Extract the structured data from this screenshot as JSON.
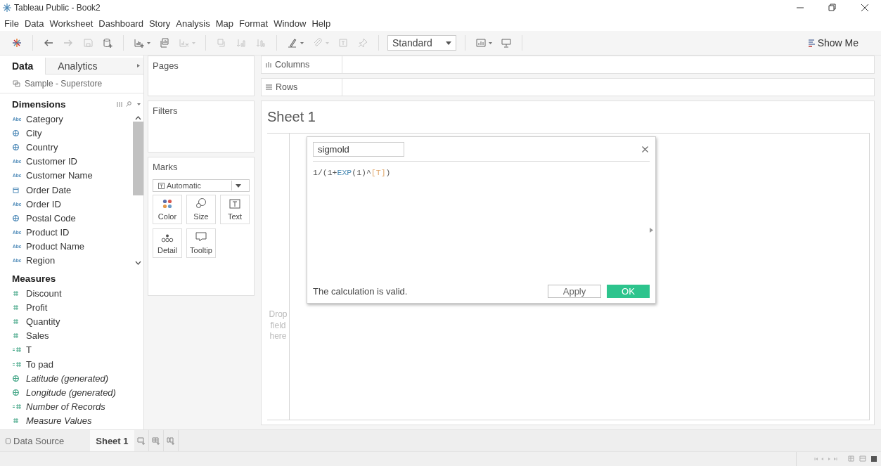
{
  "window": {
    "title": "Tableau Public - Book2"
  },
  "menu": [
    "File",
    "Data",
    "Worksheet",
    "Dashboard",
    "Story",
    "Analysis",
    "Map",
    "Format",
    "Window",
    "Help"
  ],
  "toolbar": {
    "groups": [
      [
        {
          "kind": "logo",
          "disabled": false,
          "dropdown": false
        }
      ],
      [
        {
          "kind": "undo",
          "disabled": false,
          "dropdown": false
        },
        {
          "kind": "redo",
          "disabled": true,
          "dropdown": false
        },
        {
          "kind": "save",
          "disabled": true,
          "dropdown": false
        },
        {
          "kind": "add-source",
          "disabled": false,
          "dropdown": false
        }
      ],
      [
        {
          "kind": "new-sheet",
          "disabled": false,
          "dropdown": true
        },
        {
          "kind": "duplicate",
          "disabled": false,
          "dropdown": false
        },
        {
          "kind": "clear",
          "disabled": true,
          "dropdown": true
        }
      ],
      [
        {
          "kind": "swap",
          "disabled": true,
          "dropdown": false
        },
        {
          "kind": "sort-asc",
          "disabled": true,
          "dropdown": false
        },
        {
          "kind": "sort-desc",
          "disabled": true,
          "dropdown": false
        }
      ],
      [
        {
          "kind": "highlight",
          "disabled": false,
          "dropdown": true
        },
        {
          "kind": "group",
          "disabled": true,
          "dropdown": true
        },
        {
          "kind": "labels",
          "disabled": true,
          "dropdown": false
        },
        {
          "kind": "pin",
          "disabled": true,
          "dropdown": false
        }
      ]
    ],
    "fit": "Standard",
    "groups_after": [
      [
        {
          "kind": "cards",
          "disabled": false,
          "dropdown": true
        },
        {
          "kind": "presentation",
          "disabled": false,
          "dropdown": false
        }
      ]
    ],
    "show_me": "Show Me"
  },
  "side_tabs": [
    {
      "label": "Data",
      "selected": true
    },
    {
      "label": "Analytics",
      "selected": false
    }
  ],
  "data_source": "Sample - Superstore",
  "dimensions": {
    "title": "Dimensions",
    "fields": [
      {
        "name": "Category",
        "kind": "string",
        "badge": "Abc",
        "generated": false
      },
      {
        "name": "City",
        "kind": "geo",
        "generated": false
      },
      {
        "name": "Country",
        "kind": "geo",
        "generated": false
      },
      {
        "name": "Customer ID",
        "kind": "string",
        "badge": "Abc",
        "generated": false
      },
      {
        "name": "Customer Name",
        "kind": "string",
        "badge": "Abc",
        "generated": false
      },
      {
        "name": "Order Date",
        "kind": "date",
        "generated": false
      },
      {
        "name": "Order ID",
        "kind": "string",
        "badge": "Abc",
        "generated": false
      },
      {
        "name": "Postal Code",
        "kind": "geo",
        "generated": false
      },
      {
        "name": "Product ID",
        "kind": "string",
        "badge": "Abc",
        "generated": false
      },
      {
        "name": "Product Name",
        "kind": "string",
        "badge": "Abc",
        "generated": false
      },
      {
        "name": "Region",
        "kind": "string",
        "badge": "Abc",
        "generated": false
      }
    ]
  },
  "measures": {
    "title": "Measures",
    "fields": [
      {
        "name": "Discount",
        "kind": "number",
        "generated": false
      },
      {
        "name": "Profit",
        "kind": "number",
        "generated": false
      },
      {
        "name": "Quantity",
        "kind": "number",
        "generated": false
      },
      {
        "name": "Sales",
        "kind": "number",
        "generated": false
      },
      {
        "name": "T",
        "kind": "calc",
        "generated": false
      },
      {
        "name": "To pad",
        "kind": "calc",
        "generated": false
      },
      {
        "name": "Latitude (generated)",
        "kind": "geo",
        "generated": true
      },
      {
        "name": "Longitude (generated)",
        "kind": "geo",
        "generated": true
      },
      {
        "name": "Number of Records",
        "kind": "calc",
        "generated": true
      },
      {
        "name": "Measure Values",
        "kind": "number",
        "generated": true
      }
    ]
  },
  "cards": {
    "pages": "Pages",
    "filters": "Filters",
    "marks": {
      "title": "Marks",
      "mark_type": "Automatic",
      "buttons": [
        {
          "label": "Color",
          "kind": "color"
        },
        {
          "label": "Size",
          "kind": "size"
        },
        {
          "label": "Text",
          "kind": "text"
        },
        {
          "label": "Detail",
          "kind": "detail"
        },
        {
          "label": "Tooltip",
          "kind": "tooltip"
        }
      ]
    }
  },
  "shelves": [
    {
      "label": "Columns",
      "kind": "columns"
    },
    {
      "label": "Rows",
      "kind": "rows"
    }
  ],
  "sheet": {
    "title": "Sheet 1",
    "drop_hint": "Drop field here"
  },
  "calc_dialog": {
    "name": "sigmold",
    "formula": [
      {
        "text": "1/(1+",
        "kind": "plain"
      },
      {
        "text": "EXP",
        "kind": "function"
      },
      {
        "text": "(1)^",
        "kind": "plain"
      },
      {
        "text": "[T]",
        "kind": "field"
      },
      {
        "text": ")",
        "kind": "plain"
      }
    ],
    "status": "The calculation is valid.",
    "apply": "Apply",
    "ok": "OK"
  },
  "bottom_tabs": [
    {
      "label": "Data Source",
      "kind": "source",
      "selected": false
    },
    {
      "label": "Sheet 1",
      "kind": "sheet",
      "selected": true
    }
  ]
}
